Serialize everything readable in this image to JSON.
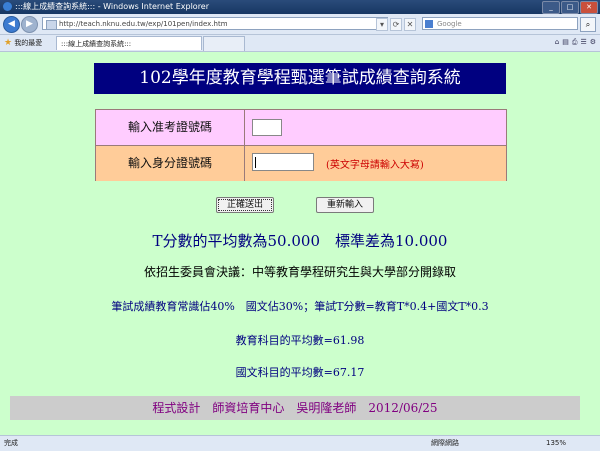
{
  "window": {
    "title": ":::線上成績查詢系統::: - Windows Internet Explorer"
  },
  "browser": {
    "url": "http://teach.nknu.edu.tw/exp/101pen/index.htm",
    "search_placeholder": "Google",
    "favorites_label": "我的最愛",
    "tab_title": ":::線上成績查詢系統:::",
    "status_done": "完成",
    "zone": "網際網路",
    "zoom": "135%"
  },
  "page": {
    "header": "102學年度教育學程甄選筆試成績查詢系統",
    "form": {
      "exam_label": "輸入准考證號碼",
      "id_label": "輸入身分證號碼",
      "id_hint": "(英文字母請輸入大寫)"
    },
    "buttons": {
      "submit": "正確送出",
      "reset": "重新輸入"
    },
    "info": {
      "tscore": "T分數的平均數為50.000　標準差為10.000",
      "decision": "依招生委員會決議：中等教育學程研究生與大學部分開錄取",
      "weights": "筆試成績教育常識佔40%　國文佔30%；筆試T分數=教育T*0.4+國文T*0.3",
      "edu_avg": "教育科目的平均數=61.98",
      "chinese_avg": "國文科目的平均數=67.17"
    },
    "footer": "程式設計　師資培育中心　吳明隆老師　2012/06/25"
  }
}
